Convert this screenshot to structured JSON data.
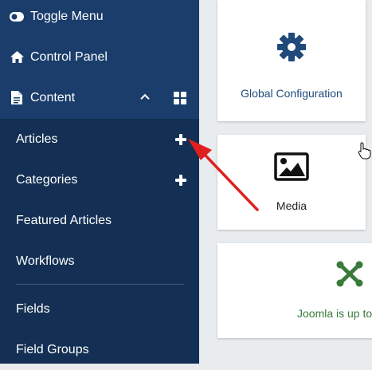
{
  "sidebar": {
    "top_items": [
      {
        "label": "Toggle Menu",
        "icon": "toggle-icon"
      },
      {
        "label": "Control Panel",
        "icon": "home-icon"
      },
      {
        "label": "Content",
        "icon": "file-icon"
      }
    ],
    "sub_items": [
      {
        "label": "Articles",
        "has_add": true
      },
      {
        "label": "Categories",
        "has_add": true
      },
      {
        "label": "Featured Articles",
        "has_add": false
      },
      {
        "label": "Workflows",
        "has_add": false
      },
      {
        "label": "Fields",
        "has_add": false
      },
      {
        "label": "Field Groups",
        "has_add": false
      }
    ]
  },
  "cards": {
    "global_config": {
      "label": "Global Configuration",
      "icon": "gear-icon",
      "color": "#1f4a7a"
    },
    "media": {
      "label": "Media",
      "icon": "image-icon",
      "color": "#222222"
    },
    "joomla": {
      "label": "Joomla is up to",
      "icon": "joomla-logo-icon",
      "color": "#3a7a3a"
    }
  },
  "colors": {
    "sidebar_top": "#1a3d6b",
    "sidebar_sub": "#132f53",
    "arrow": "#e02020"
  }
}
